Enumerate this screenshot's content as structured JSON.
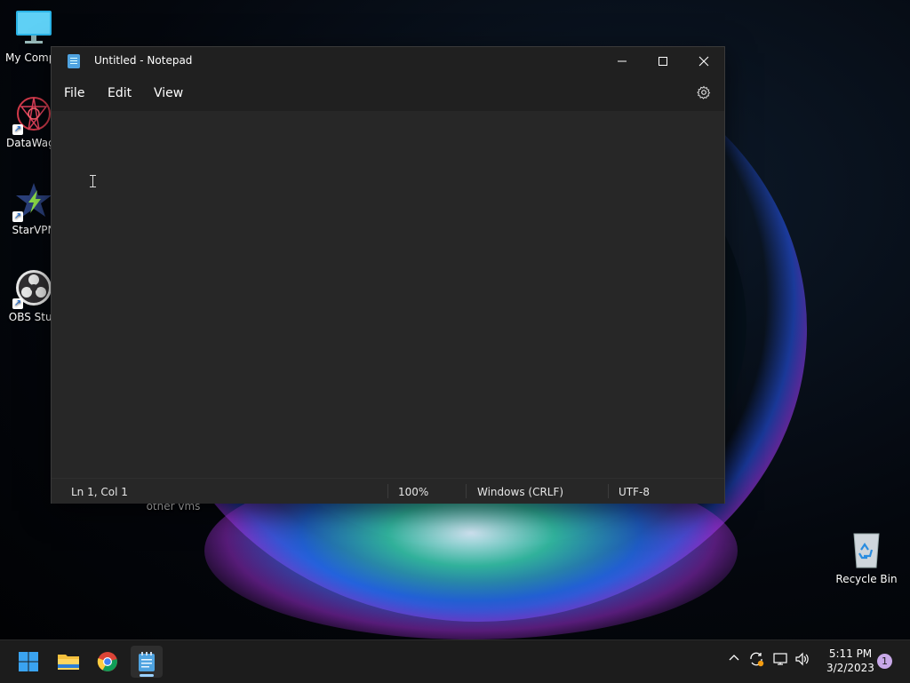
{
  "desktop": {
    "icons": [
      {
        "label": "My Compu",
        "icon": "monitor-icon"
      },
      {
        "label": "DataWago",
        "icon": "datawagon-icon"
      },
      {
        "label": "StarVPN",
        "icon": "starvpn-icon"
      },
      {
        "label": "OBS Stud",
        "icon": "obs-studio-icon"
      }
    ],
    "folder_label": "other vms",
    "recycle_bin": {
      "label": "Recycle Bin",
      "icon": "recycle-bin-icon"
    }
  },
  "notepad": {
    "title": "Untitled - Notepad",
    "menu": [
      "File",
      "Edit",
      "View"
    ],
    "content": "",
    "status": {
      "position": "Ln 1, Col 1",
      "zoom": "100%",
      "line_ending": "Windows (CRLF)",
      "encoding": "UTF-8"
    }
  },
  "taskbar": {
    "apps": [
      "start-icon",
      "file-explorer-icon",
      "chrome-icon",
      "notepad-icon"
    ],
    "tray_icons": [
      "chevron-up-icon",
      "sync-icon",
      "network-icon",
      "volume-icon"
    ],
    "time": "5:11 PM",
    "date": "3/2/2023",
    "notification_count": "1"
  },
  "colors": {
    "accent": "#4fa3e0",
    "window_bg": "#272727",
    "titlebar_bg": "#202020",
    "taskbar_bg": "#1c1c1c"
  }
}
